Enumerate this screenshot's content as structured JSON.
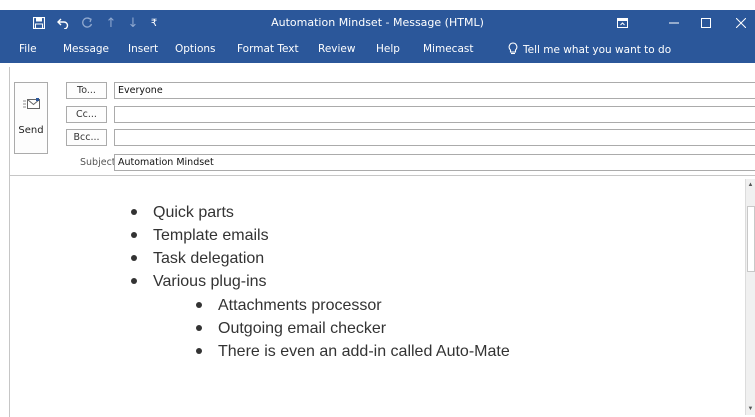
{
  "window": {
    "title": "Automation Mindset - Message (HTML)"
  },
  "ribbon": {
    "tabs": [
      "File",
      "Message",
      "Insert",
      "Options",
      "Format Text",
      "Review",
      "Help",
      "Mimecast"
    ],
    "tell_me": "Tell me what you want to do"
  },
  "header": {
    "send_label": "Send",
    "to_button": "To...",
    "cc_button": "Cc...",
    "bcc_button": "Bcc...",
    "to_value": "Everyone",
    "cc_value": "",
    "bcc_value": "",
    "subject_label": "Subject",
    "subject_value": "Automation Mindset"
  },
  "body": {
    "items": [
      "Quick parts",
      "Template emails",
      "Task delegation",
      "Various plug-ins"
    ],
    "subitems": [
      "Attachments processor",
      "Outgoing email checker",
      "There is even an add-in called Auto-Mate"
    ]
  },
  "icons": {
    "save": "save-icon",
    "undo": "undo-icon",
    "redo": "redo-icon",
    "up": "up-arrow-icon",
    "down": "down-arrow-icon",
    "customize": "customize-qat-icon",
    "ribbon_display": "ribbon-display-options-icon",
    "minimize": "minimize-icon",
    "maximize": "maximize-icon",
    "close": "close-icon",
    "lightbulb": "lightbulb-icon",
    "send": "send-icon"
  },
  "colors": {
    "accent": "#2b579a"
  }
}
